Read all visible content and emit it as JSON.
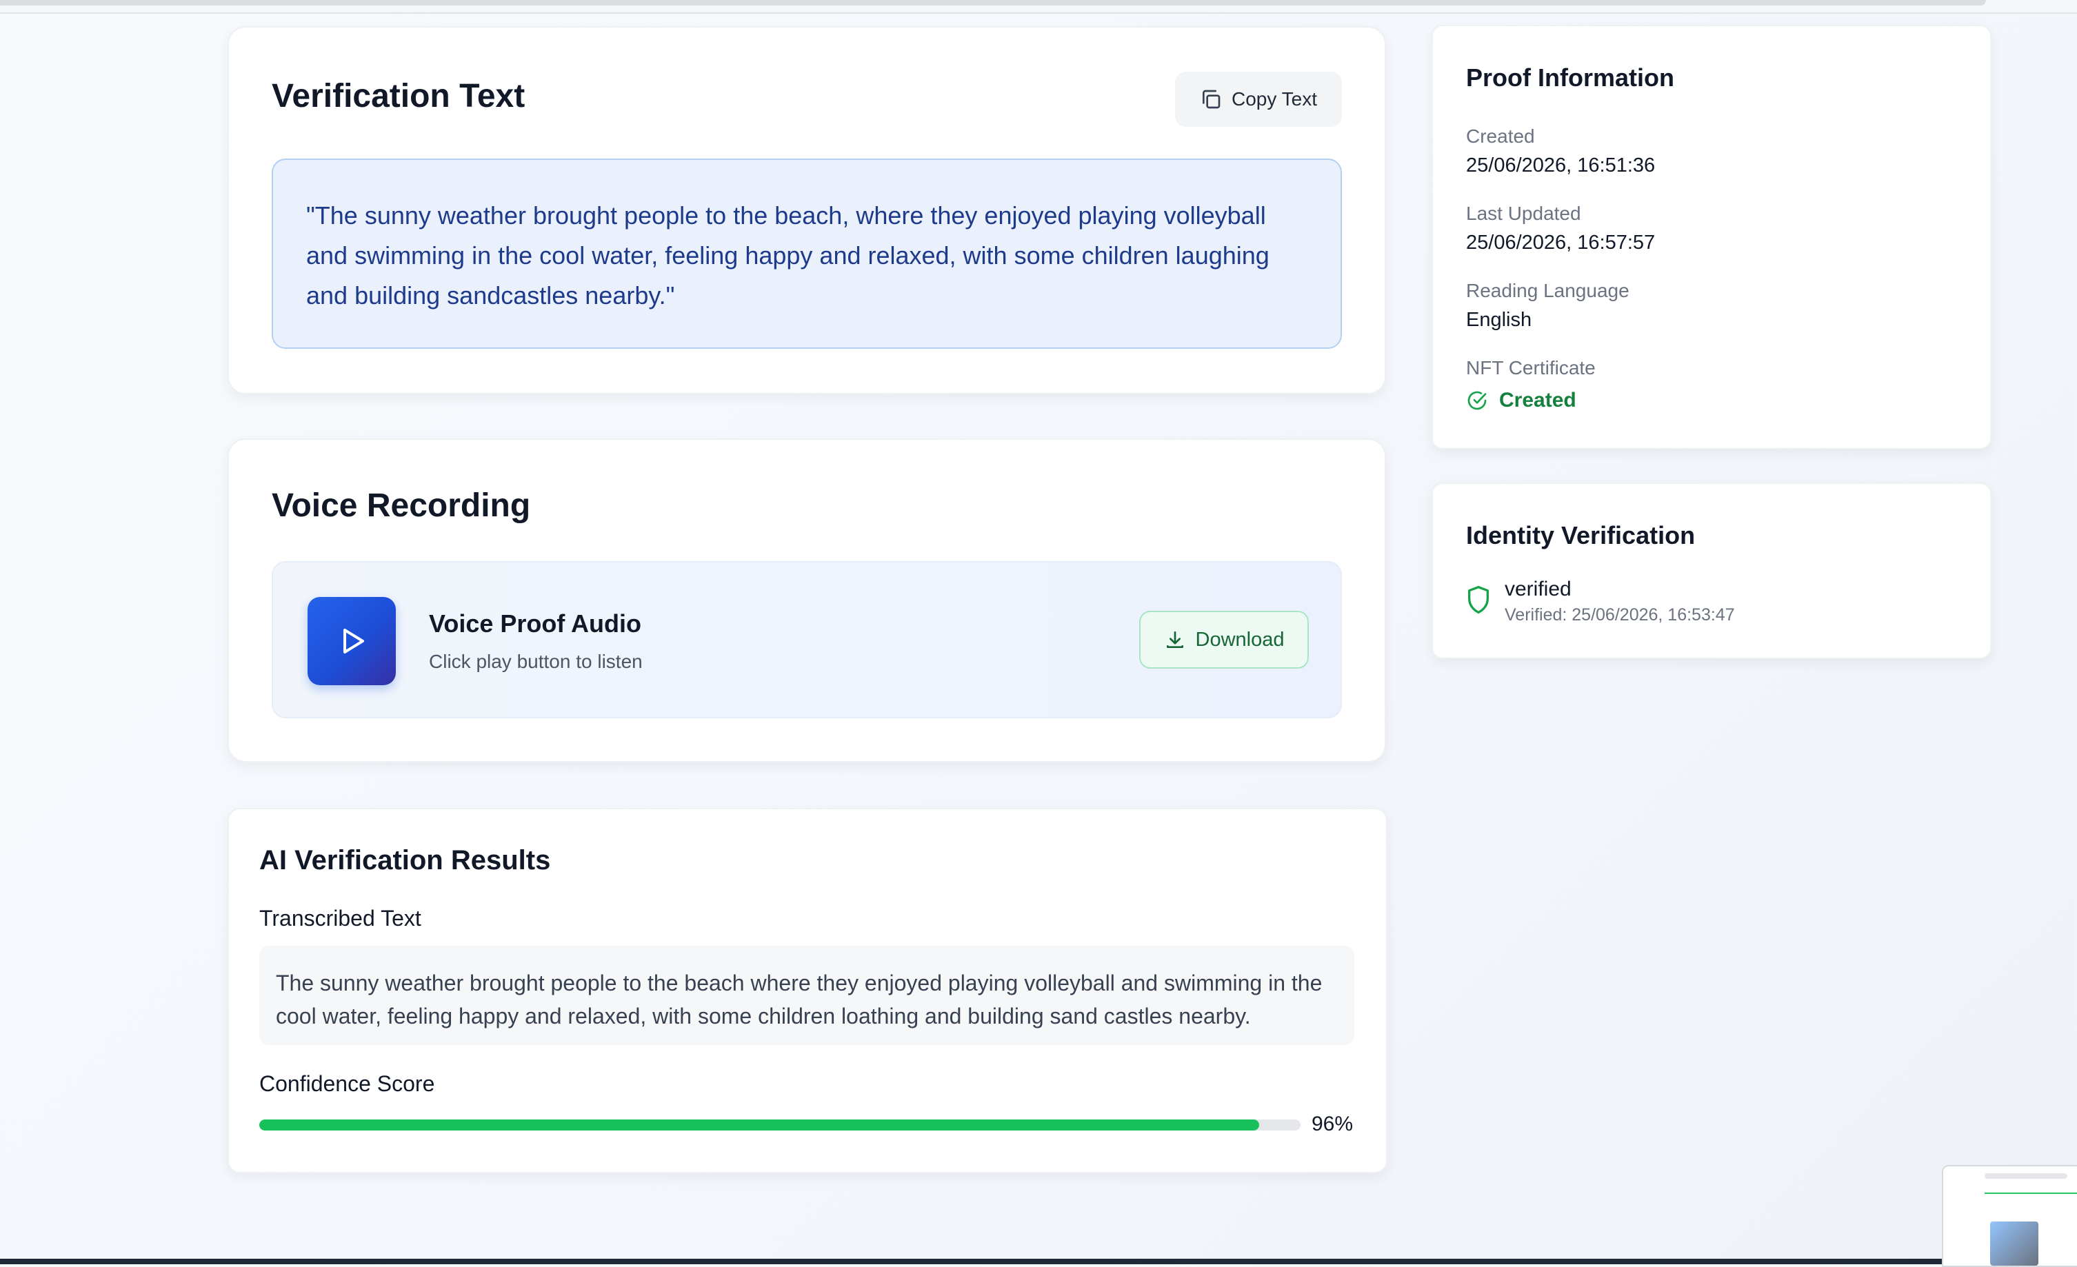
{
  "verification_text": {
    "title": "Verification Text",
    "copy_label": "Copy Text",
    "quote": "\"The sunny weather brought people to the beach, where they enjoyed playing volleyball and swimming in the cool water, feeling happy and relaxed, with some children laughing and building sandcastles nearby.\""
  },
  "voice_recording": {
    "title": "Voice Recording",
    "audio_title": "Voice Proof Audio",
    "audio_subtitle": "Click play button to listen",
    "download_label": "Download"
  },
  "ai_results": {
    "title": "AI Verification Results",
    "transcribed_label": "Transcribed Text",
    "transcribed_text": "The sunny weather brought people to the beach where they enjoyed playing volleyball and swimming in the cool water, feeling happy and relaxed, with some children loathing and building sand castles nearby.",
    "confidence_label": "Confidence Score",
    "confidence_value": 96,
    "confidence_text": "96%"
  },
  "proof_info": {
    "title": "Proof Information",
    "fields": [
      {
        "label": "Created",
        "value": "25/06/2026, 16:51:36"
      },
      {
        "label": "Last Updated",
        "value": "25/06/2026, 16:57:57"
      },
      {
        "label": "Reading Language",
        "value": "English"
      },
      {
        "label": "NFT Certificate",
        "value": "Created"
      }
    ]
  },
  "identity": {
    "title": "Identity Verification",
    "status": "verified",
    "verified_at": "Verified: 25/06/2026, 16:53:47"
  },
  "colors": {
    "accent_blue": "#2563eb",
    "success_green": "#16a34a",
    "progress_green": "#16c05a"
  },
  "icons": {
    "copy": "copy-icon",
    "play": "play-icon",
    "download": "download-icon",
    "nft_status": "check-circle-icon",
    "identity": "shield-icon"
  }
}
